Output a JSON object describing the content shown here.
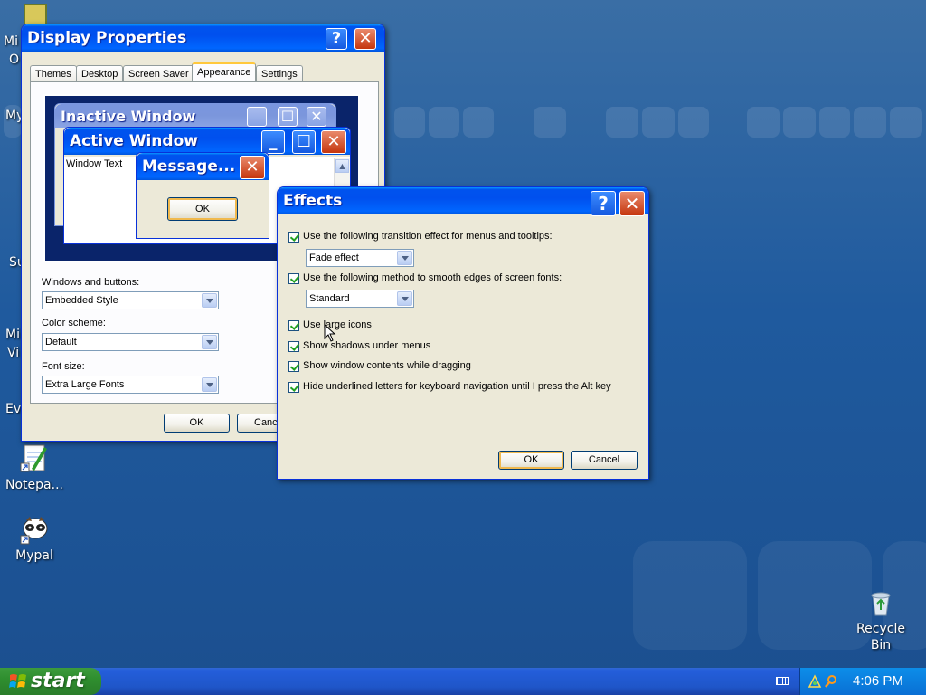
{
  "desktop": {
    "icons": [
      {
        "name": "Notepa...",
        "icon": "notepad-icon"
      },
      {
        "name": "Mypal",
        "icon": "mypal-icon"
      },
      {
        "name": "Recycle Bin",
        "icon": "recycle-bin-icon"
      }
    ],
    "left_fragments": [
      "Mi",
      "O",
      "My",
      "Su",
      "Mi",
      "Vi",
      "Ev"
    ]
  },
  "display_properties": {
    "title": "Display Properties",
    "tabs": [
      "Themes",
      "Desktop",
      "Screen Saver",
      "Appearance",
      "Settings"
    ],
    "active_tab": "Appearance",
    "preview": {
      "inactive_title": "Inactive Window",
      "active_title": "Active Window",
      "window_text": "Window Text",
      "message_title": "Message...",
      "message_ok": "OK"
    },
    "windows_buttons_label": "Windows and buttons:",
    "windows_buttons_value": "Embedded Style",
    "color_scheme_label": "Color scheme:",
    "color_scheme_value": "Default",
    "font_size_label": "Font size:",
    "font_size_value": "Extra Large Fonts",
    "ok": "OK",
    "cancel": "Canc"
  },
  "effects": {
    "title": "Effects",
    "transition_label": "Use the following transition effect for menus and tooltips:",
    "transition_checked": true,
    "transition_value": "Fade effect",
    "smooth_label": "Use the following method to smooth edges of screen fonts:",
    "smooth_checked": true,
    "smooth_value": "Standard",
    "options": [
      {
        "label": "Use large icons",
        "checked": true
      },
      {
        "label": "Show shadows under menus",
        "checked": true
      },
      {
        "label": "Show window contents while dragging",
        "checked": true
      },
      {
        "label": "Hide underlined letters for keyboard navigation until I press the Alt key",
        "checked": true
      }
    ],
    "ok": "OK",
    "cancel": "Cancel"
  },
  "taskbar": {
    "start": "start",
    "clock": "4:06 PM"
  },
  "colors": {
    "xp_blue": "#0054e3",
    "close_red": "#e04b1f",
    "default_button_outline": "#f0b94e"
  }
}
